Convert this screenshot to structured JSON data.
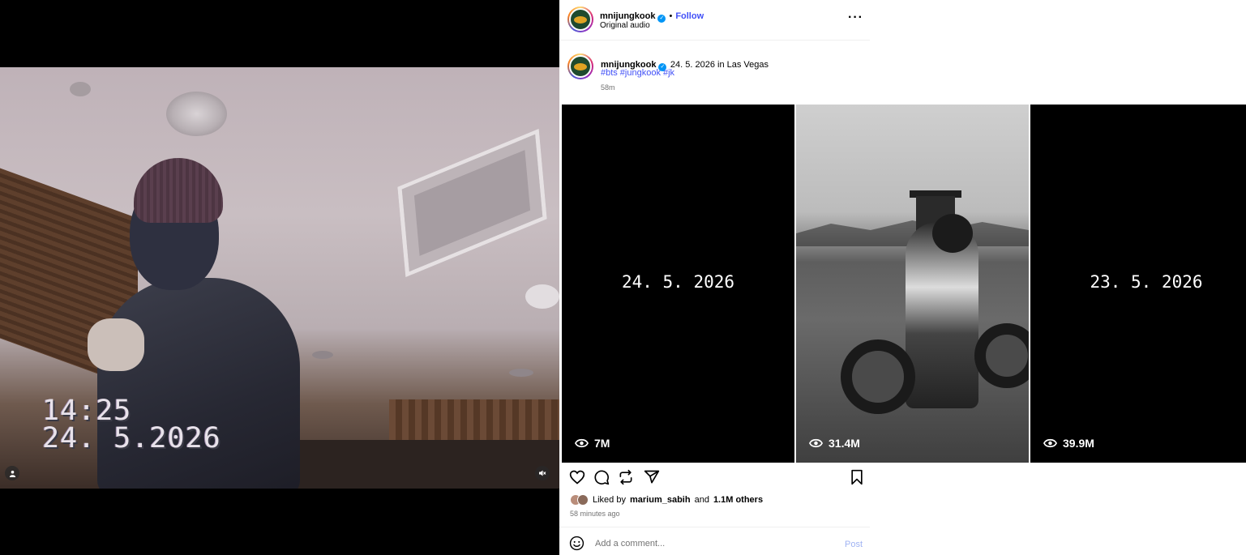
{
  "video": {
    "timestamp_time": "14:25",
    "timestamp_date": "24. 5.2026"
  },
  "header": {
    "username": "mnijungkook",
    "separator": "•",
    "follow_label": "Follow",
    "audio_label": "Original audio",
    "more_label": "···"
  },
  "caption": {
    "username": "mnijungkook",
    "text": "24. 5. 2026 in Las Vegas",
    "hashtags": [
      "#bts",
      "#jungkook",
      "#jk"
    ],
    "time": "58m"
  },
  "reels": [
    {
      "date": "24. 5. 2026",
      "views": "7M"
    },
    {
      "date": "",
      "views": "31.4M"
    },
    {
      "date": "23. 5. 2026",
      "views": "39.9M"
    }
  ],
  "likes": {
    "prefix": "Liked by",
    "user": "marium_sabih",
    "joiner": "and",
    "others": "1.1M others",
    "ago": "58 minutes ago"
  },
  "comment": {
    "placeholder": "Add a comment...",
    "post_label": "Post"
  },
  "colors": {
    "link": "#4150f7",
    "verified": "#0095f6",
    "post_disabled": "#a0b3f3"
  }
}
